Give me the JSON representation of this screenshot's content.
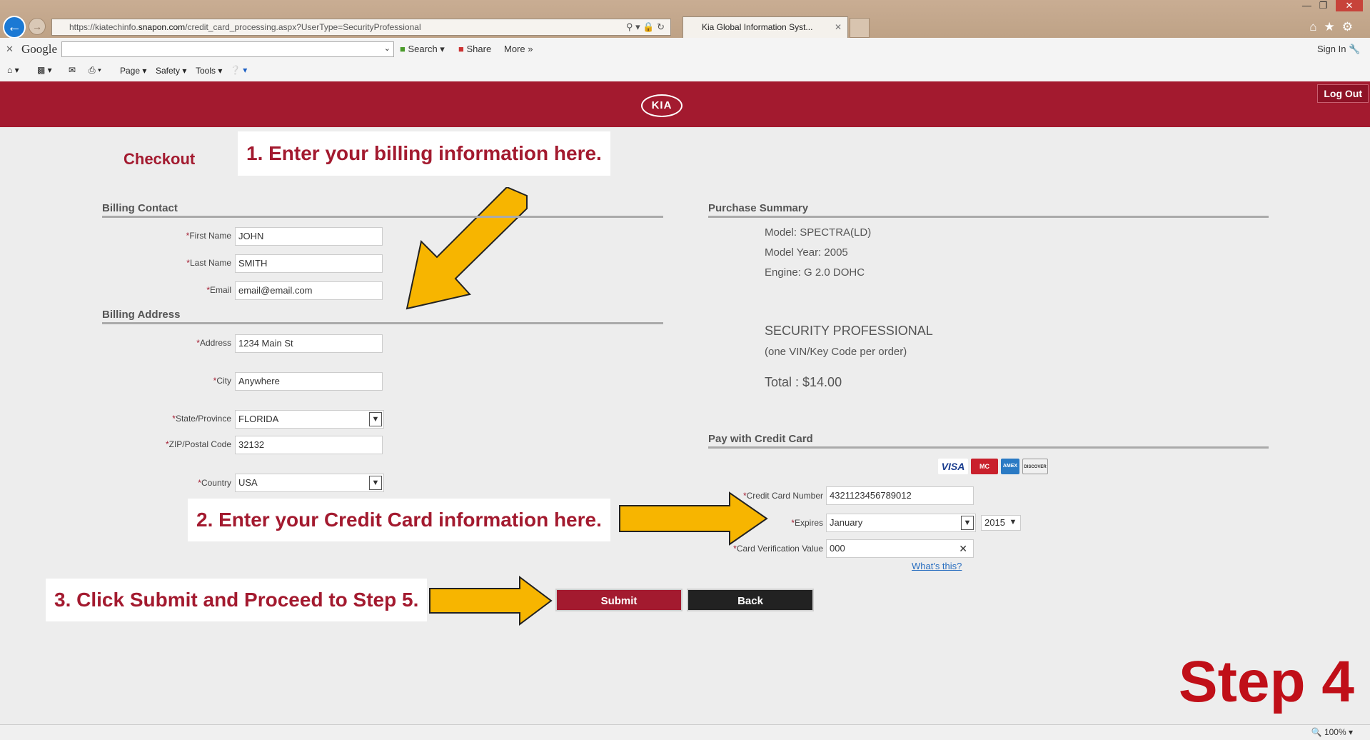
{
  "browser": {
    "url_prefix": "https://kiatechinfo.",
    "url_host": "snapon.com",
    "url_path": "/credit_card_processing.aspx?UserType=SecurityProfessional",
    "tab_title": "Kia Global Information Syst...",
    "toolbar": {
      "search_label": "Search",
      "share_label": "Share",
      "more_label": "More",
      "sign_in_label": "Sign In",
      "page_label": "Page",
      "safety_label": "Safety",
      "tools_label": "Tools",
      "google_label": "Google"
    },
    "zoom": "100%"
  },
  "header": {
    "logo_text": "KIA",
    "logout_label": "Log Out"
  },
  "page": {
    "title": "Checkout",
    "step": "Step 4"
  },
  "callouts": {
    "one": "1. Enter your billing information here.",
    "two": "2. Enter your Credit Card information here.",
    "three": "3. Click Submit and Proceed to Step 5."
  },
  "billing_contact": {
    "heading": "Billing Contact",
    "first_name_label": "First Name",
    "first_name": "JOHN",
    "last_name_label": "Last Name",
    "last_name": "SMITH",
    "email_label": "Email",
    "email": "email@email.com"
  },
  "billing_address": {
    "heading": "Billing Address",
    "address_label": "Address",
    "address": "1234 Main St",
    "city_label": "City",
    "city": "Anywhere",
    "state_label": "State/Province",
    "state": "FLORIDA",
    "zip_label": "ZIP/Postal Code",
    "zip": "32132",
    "country_label": "Country",
    "country": "USA"
  },
  "purchase_summary": {
    "heading": "Purchase Summary",
    "model": "Model: SPECTRA(LD)",
    "model_year": "Model Year: 2005",
    "engine": "Engine: G 2.0 DOHC",
    "package": "SECURITY PROFESSIONAL",
    "package_note": "(one VIN/Key Code per order)",
    "total": "Total : $14.00"
  },
  "payment": {
    "heading": "Pay with Credit Card",
    "cards": [
      "VISA",
      "MC",
      "AMEX",
      "DISCOVER"
    ],
    "card_number_label": "Credit Card Number",
    "card_number": "4321123456789012",
    "expires_label": "Expires",
    "expires_month": "January",
    "expires_year": "2015",
    "cvv_label": "Card Verification Value",
    "cvv": "000",
    "whats_this": "What's this?"
  },
  "buttons": {
    "submit": "Submit",
    "back": "Back"
  },
  "colors": {
    "brand": "#a31a2f",
    "arrow": "#f7b500",
    "step": "#c00f18"
  }
}
